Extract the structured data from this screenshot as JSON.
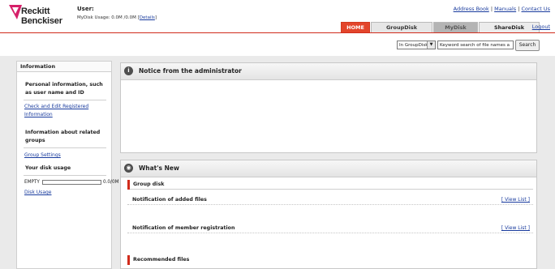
{
  "brand": {
    "line1": "Reckitt",
    "line2": "Benckiser",
    "mark_color": "#d61f69"
  },
  "header": {
    "user_label": "User:",
    "usage_text": "MyDisk Usage: 0.0M /0.0M",
    "details_link": "Details",
    "links": [
      "Address Book",
      "Manuals",
      "Contact Us"
    ],
    "logout": "Logout"
  },
  "nav": {
    "tabs": [
      "HOME",
      "GroupDisk",
      "MyDisk",
      "ShareDisk"
    ],
    "active": "HOME",
    "accent": "#e3452b"
  },
  "search": {
    "scope": "In GroupDisk",
    "input_value": "Keyword search of file names a",
    "button": "Search"
  },
  "sidebar": {
    "title": "Information",
    "personal_heading": "Personal information, such as user name and ID",
    "personal_link": "Check and Edit Registered Information",
    "related_heading": "Information about related groups",
    "group_link": "Group Settings",
    "disk_heading": "Your disk usage",
    "disk_empty": "EMPTY",
    "disk_value": "0.0/0M",
    "disk_fill": 0,
    "disk_link": "Disk Usage"
  },
  "notice": {
    "title": "Notice from the administrator"
  },
  "whats_new": {
    "title": "What's New",
    "group_disk": "Group disk",
    "added_files": "Notification of added files",
    "member_registration": "Notification of member registration",
    "view_list": "[ View List ]",
    "recommended": "Recommended files"
  }
}
